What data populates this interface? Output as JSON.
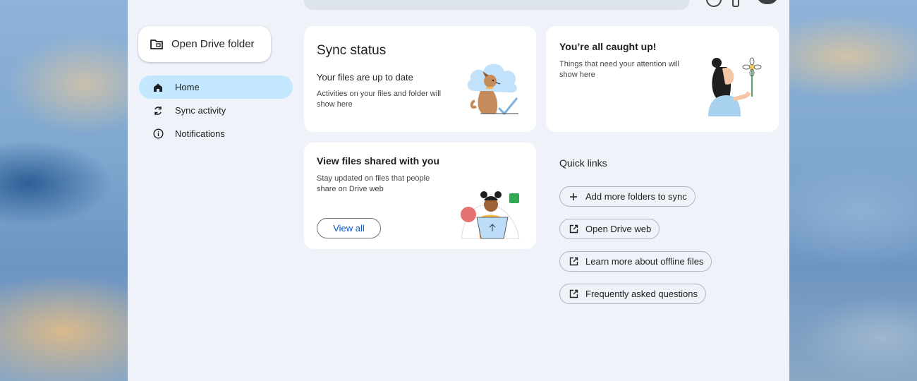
{
  "app": {
    "name": "Drive"
  },
  "sidebar": {
    "open_folder_label": "Open Drive folder",
    "items": [
      {
        "label": "Home",
        "icon": "home-icon",
        "active": true
      },
      {
        "label": "Sync activity",
        "icon": "sync-icon",
        "active": false
      },
      {
        "label": "Notifications",
        "icon": "info-icon",
        "active": false
      }
    ]
  },
  "sync_card": {
    "title": "Sync status",
    "subtitle": "Your files are up to date",
    "description": "Activities on your files and folder will show here"
  },
  "caught_up_card": {
    "title": "You’re all caught up!",
    "description": "Things that need your attention will show here"
  },
  "shared_card": {
    "title": "View files shared with you",
    "description": "Stay updated on files that people share on Drive web",
    "button_label": "View all"
  },
  "quick_links": {
    "heading": "Quick links",
    "items": [
      {
        "label": "Add more folders to sync",
        "icon": "plus-icon"
      },
      {
        "label": "Open Drive web",
        "icon": "open-external-icon"
      },
      {
        "label": "Learn more about offline files",
        "icon": "open-external-icon"
      },
      {
        "label": "Frequently asked questions",
        "icon": "open-external-icon"
      }
    ]
  },
  "colors": {
    "accent": "#0b57d0",
    "active_nav": "#c2e7ff",
    "window_bg": "#eff3f9",
    "card_bg": "#ffffff"
  }
}
